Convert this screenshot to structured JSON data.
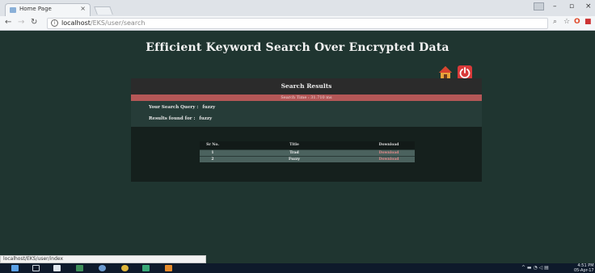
{
  "browser": {
    "tab_title": "Home Page",
    "tab_close": "×",
    "url_host": "localhost",
    "url_path": "/EKS/user/search",
    "status_url": "localhost/EKS/user/index"
  },
  "site": {
    "title": "Efficient Keyword Search Over Encrypted Data"
  },
  "results_panel": {
    "heading": "Search Results",
    "search_time": "Search Time : 31.710 ms",
    "query_label": "Your Search Query :",
    "query_value": "fuzzy",
    "found_label": "Results found for  :",
    "found_value": "fuzzy",
    "table": {
      "headers": [
        "Sr No.",
        "Title",
        "Download"
      ],
      "rows": [
        {
          "sr": "1",
          "title": "Trad",
          "download": "Download"
        },
        {
          "sr": "2",
          "title": "Fuzzy",
          "download": "Download"
        }
      ]
    }
  },
  "taskbar": {
    "time": "4:51 PM",
    "date": "05-Apr-17"
  },
  "colors": {
    "page_bg": "#1f3530",
    "panel_bar": "#b55757",
    "power_button": "#d93a3a"
  }
}
